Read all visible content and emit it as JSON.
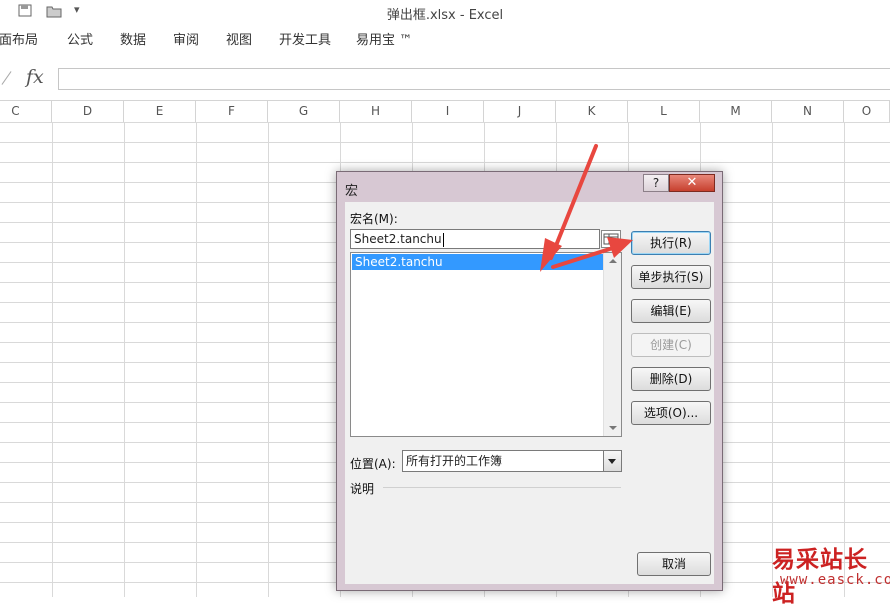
{
  "window": {
    "title": "弹出框.xlsx - Excel"
  },
  "ribbon": {
    "tabs": [
      "页面布局",
      "公式",
      "数据",
      "审阅",
      "视图",
      "开发工具",
      "易用宝 ™"
    ]
  },
  "formula_bar": {
    "fx_label": "fx",
    "value": ""
  },
  "columns": [
    "C",
    "D",
    "E",
    "F",
    "G",
    "H",
    "I",
    "J",
    "K",
    "L",
    "M",
    "N",
    "O"
  ],
  "dialog": {
    "title": "宏",
    "help_label": "?",
    "close_label": "✕",
    "macro_name_label": "宏名(M):",
    "macro_name_value": "Sheet2.tanchu",
    "macro_list": [
      "Sheet2.tanchu"
    ],
    "buttons": {
      "run": "执行(R)",
      "step_into": "单步执行(S)",
      "edit": "编辑(E)",
      "create": "创建(C)",
      "delete": "删除(D)",
      "options": "选项(O)...",
      "cancel": "取消"
    },
    "location_label": "位置(A):",
    "location_value": "所有打开的工作簿",
    "description_label": "说明"
  },
  "watermark": {
    "logo": "易采站长站",
    "url": "www.easck.com"
  },
  "colors": {
    "annotation_arrow": "#e8473f",
    "selection": "#3399ff",
    "close_button": "#c7402e"
  }
}
